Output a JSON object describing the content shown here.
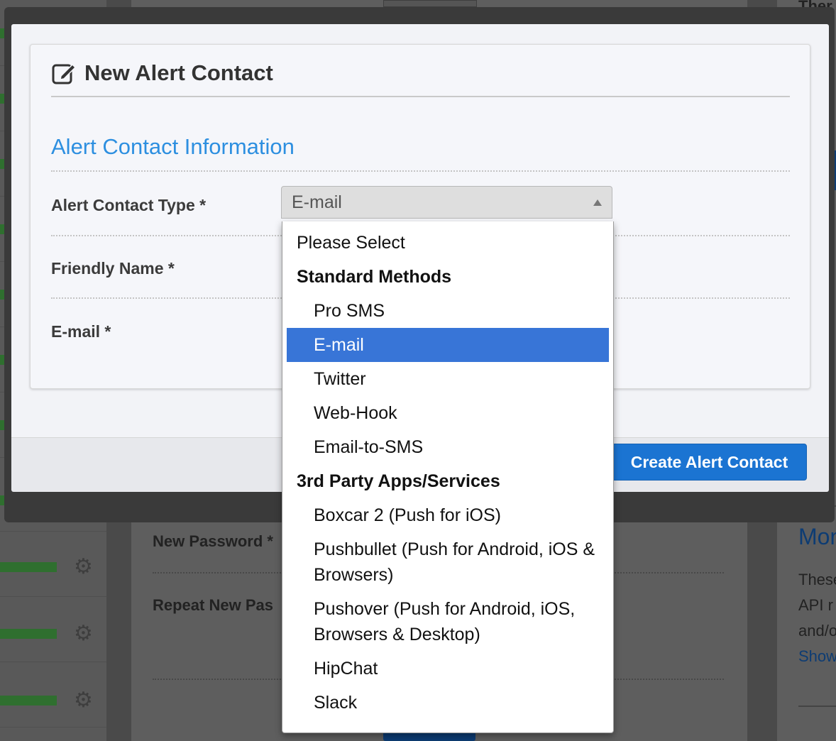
{
  "background": {
    "labels": [
      "New Password *",
      "Repeat New Pas"
    ],
    "right_texts": [
      "Ther",
      "These",
      "API r",
      "and/o"
    ],
    "right_heading": "Mon",
    "right_link": "Show"
  },
  "modal": {
    "title": "New Alert Contact",
    "title_icon": "edit-icon",
    "section_title": "Alert Contact Information",
    "fields": {
      "type_label": "Alert Contact Type *",
      "friendly_name_label": "Friendly Name *",
      "email_label": "E-mail *"
    },
    "select": {
      "value": "E-mail"
    },
    "create_button": "Create Alert Contact"
  },
  "dropdown": {
    "placeholder": "Please Select",
    "groups": [
      {
        "label": "Standard Methods",
        "options": [
          "Pro SMS",
          "E-mail",
          "Twitter",
          "Web-Hook",
          "Email-to-SMS"
        ]
      },
      {
        "label": "3rd Party Apps/Services",
        "options": [
          "Boxcar 2 (Push for iOS)",
          "Pushbullet (Push for Android, iOS & Browsers)",
          "Pushover (Push for Android, iOS, Browsers & Desktop)",
          "HipChat",
          "Slack"
        ]
      }
    ],
    "selected": "E-mail"
  },
  "colors": {
    "accent": "#2d8fe0",
    "button": "#1b74d2",
    "selected_option": "#3875d7"
  }
}
